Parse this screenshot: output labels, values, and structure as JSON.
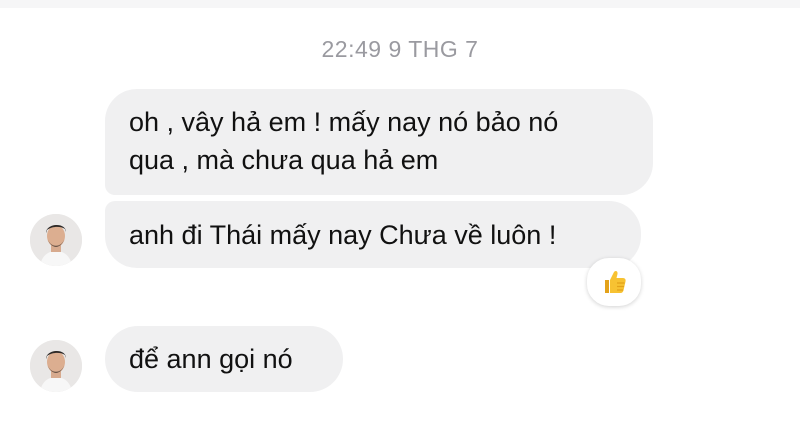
{
  "thread": {
    "timestamp": "22:49 9 THG 7",
    "messages": [
      {
        "sender": "other",
        "lines": [
          "oh , vây hả em ! mấy nay nó bảo nó",
          "qua , mà chưa qua hả em"
        ]
      },
      {
        "sender": "other",
        "text": "anh đi Thái mấy nay Chưa về luôn !",
        "reaction": "thumbs-up-icon"
      },
      {
        "sender": "other",
        "text": "để ann gọi nó"
      }
    ]
  },
  "colors": {
    "background": "#ffffff",
    "bubble": "#f0f0f1",
    "timestamp": "#9a9aa0",
    "text": "#111111",
    "reaction_yellow": "#f7c232"
  }
}
